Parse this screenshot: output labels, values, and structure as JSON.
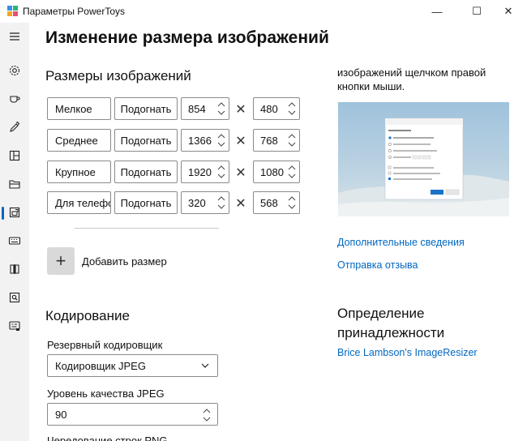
{
  "window": {
    "title": "Параметры PowerToys",
    "minimize_glyph": "—",
    "maximize_glyph": "☐",
    "close_glyph": "✕"
  },
  "sidebar": {
    "menu_icon": "hamburger-icon",
    "items": [
      {
        "icon": "gear-icon",
        "active": false
      },
      {
        "icon": "coffee-cup-icon",
        "active": false
      },
      {
        "icon": "color-picker-icon",
        "active": false
      },
      {
        "icon": "fancyzones-icon",
        "active": false
      },
      {
        "icon": "file-explorer-icon",
        "active": false
      },
      {
        "icon": "image-resizer-icon",
        "active": true
      },
      {
        "icon": "keyboard-icon",
        "active": false
      },
      {
        "icon": "power-rename-icon",
        "active": false
      },
      {
        "icon": "run-search-icon",
        "active": false
      },
      {
        "icon": "shortcut-guide-icon",
        "active": false
      }
    ],
    "accent": "#0067c0"
  },
  "page": {
    "title": "Изменение размера изображений"
  },
  "sizes": {
    "heading": "Размеры изображений",
    "times_glyph": "✕",
    "rows": [
      {
        "name": "Мелкое",
        "fit": "Подогнать",
        "width": "854",
        "height": "480"
      },
      {
        "name": "Среднее",
        "fit": "Подогнать",
        "width": "1366",
        "height": "768"
      },
      {
        "name": "Крупное",
        "fit": "Подогнать",
        "width": "1920",
        "height": "1080"
      },
      {
        "name": "Для телефона",
        "fit": "Подогнать",
        "width": "320",
        "height": "568"
      }
    ],
    "add_glyph": "+",
    "add_label": "Добавить размер"
  },
  "encoding": {
    "heading": "Кодирование",
    "fallback_label": "Резервный кодировщик",
    "fallback_value": "Кодировщик JPEG",
    "quality_label": "Уровень качества JPEG",
    "quality_value": "90",
    "png_label": "Чередование строк PNG"
  },
  "side": {
    "description": "изображений щелчком правой кнопки мыши.",
    "link_more": "Дополнительные сведения",
    "link_feedback": "Отправка отзыва",
    "attribution_heading": "Определение принадлежности",
    "attribution_link": "Brice Lambson's ImageResizer"
  }
}
